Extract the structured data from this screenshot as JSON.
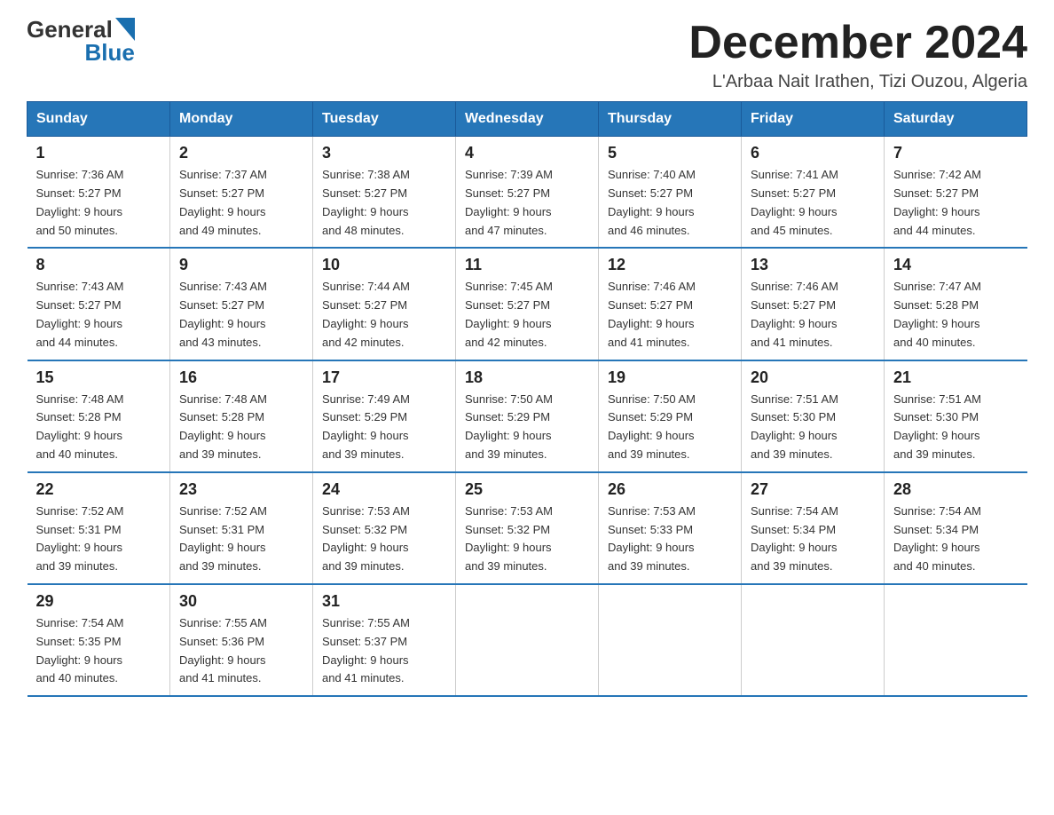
{
  "logo": {
    "general": "General",
    "blue": "Blue"
  },
  "title": "December 2024",
  "location": "L'Arbaa Nait Irathen, Tizi Ouzou, Algeria",
  "weekdays": [
    "Sunday",
    "Monday",
    "Tuesday",
    "Wednesday",
    "Thursday",
    "Friday",
    "Saturday"
  ],
  "weeks": [
    [
      {
        "day": "1",
        "sunrise": "7:36 AM",
        "sunset": "5:27 PM",
        "daylight": "9 hours and 50 minutes."
      },
      {
        "day": "2",
        "sunrise": "7:37 AM",
        "sunset": "5:27 PM",
        "daylight": "9 hours and 49 minutes."
      },
      {
        "day": "3",
        "sunrise": "7:38 AM",
        "sunset": "5:27 PM",
        "daylight": "9 hours and 48 minutes."
      },
      {
        "day": "4",
        "sunrise": "7:39 AM",
        "sunset": "5:27 PM",
        "daylight": "9 hours and 47 minutes."
      },
      {
        "day": "5",
        "sunrise": "7:40 AM",
        "sunset": "5:27 PM",
        "daylight": "9 hours and 46 minutes."
      },
      {
        "day": "6",
        "sunrise": "7:41 AM",
        "sunset": "5:27 PM",
        "daylight": "9 hours and 45 minutes."
      },
      {
        "day": "7",
        "sunrise": "7:42 AM",
        "sunset": "5:27 PM",
        "daylight": "9 hours and 44 minutes."
      }
    ],
    [
      {
        "day": "8",
        "sunrise": "7:43 AM",
        "sunset": "5:27 PM",
        "daylight": "9 hours and 44 minutes."
      },
      {
        "day": "9",
        "sunrise": "7:43 AM",
        "sunset": "5:27 PM",
        "daylight": "9 hours and 43 minutes."
      },
      {
        "day": "10",
        "sunrise": "7:44 AM",
        "sunset": "5:27 PM",
        "daylight": "9 hours and 42 minutes."
      },
      {
        "day": "11",
        "sunrise": "7:45 AM",
        "sunset": "5:27 PM",
        "daylight": "9 hours and 42 minutes."
      },
      {
        "day": "12",
        "sunrise": "7:46 AM",
        "sunset": "5:27 PM",
        "daylight": "9 hours and 41 minutes."
      },
      {
        "day": "13",
        "sunrise": "7:46 AM",
        "sunset": "5:27 PM",
        "daylight": "9 hours and 41 minutes."
      },
      {
        "day": "14",
        "sunrise": "7:47 AM",
        "sunset": "5:28 PM",
        "daylight": "9 hours and 40 minutes."
      }
    ],
    [
      {
        "day": "15",
        "sunrise": "7:48 AM",
        "sunset": "5:28 PM",
        "daylight": "9 hours and 40 minutes."
      },
      {
        "day": "16",
        "sunrise": "7:48 AM",
        "sunset": "5:28 PM",
        "daylight": "9 hours and 39 minutes."
      },
      {
        "day": "17",
        "sunrise": "7:49 AM",
        "sunset": "5:29 PM",
        "daylight": "9 hours and 39 minutes."
      },
      {
        "day": "18",
        "sunrise": "7:50 AM",
        "sunset": "5:29 PM",
        "daylight": "9 hours and 39 minutes."
      },
      {
        "day": "19",
        "sunrise": "7:50 AM",
        "sunset": "5:29 PM",
        "daylight": "9 hours and 39 minutes."
      },
      {
        "day": "20",
        "sunrise": "7:51 AM",
        "sunset": "5:30 PM",
        "daylight": "9 hours and 39 minutes."
      },
      {
        "day": "21",
        "sunrise": "7:51 AM",
        "sunset": "5:30 PM",
        "daylight": "9 hours and 39 minutes."
      }
    ],
    [
      {
        "day": "22",
        "sunrise": "7:52 AM",
        "sunset": "5:31 PM",
        "daylight": "9 hours and 39 minutes."
      },
      {
        "day": "23",
        "sunrise": "7:52 AM",
        "sunset": "5:31 PM",
        "daylight": "9 hours and 39 minutes."
      },
      {
        "day": "24",
        "sunrise": "7:53 AM",
        "sunset": "5:32 PM",
        "daylight": "9 hours and 39 minutes."
      },
      {
        "day": "25",
        "sunrise": "7:53 AM",
        "sunset": "5:32 PM",
        "daylight": "9 hours and 39 minutes."
      },
      {
        "day": "26",
        "sunrise": "7:53 AM",
        "sunset": "5:33 PM",
        "daylight": "9 hours and 39 minutes."
      },
      {
        "day": "27",
        "sunrise": "7:54 AM",
        "sunset": "5:34 PM",
        "daylight": "9 hours and 39 minutes."
      },
      {
        "day": "28",
        "sunrise": "7:54 AM",
        "sunset": "5:34 PM",
        "daylight": "9 hours and 40 minutes."
      }
    ],
    [
      {
        "day": "29",
        "sunrise": "7:54 AM",
        "sunset": "5:35 PM",
        "daylight": "9 hours and 40 minutes."
      },
      {
        "day": "30",
        "sunrise": "7:55 AM",
        "sunset": "5:36 PM",
        "daylight": "9 hours and 41 minutes."
      },
      {
        "day": "31",
        "sunrise": "7:55 AM",
        "sunset": "5:37 PM",
        "daylight": "9 hours and 41 minutes."
      },
      null,
      null,
      null,
      null
    ]
  ],
  "labels": {
    "sunrise": "Sunrise:",
    "sunset": "Sunset:",
    "daylight": "Daylight:"
  }
}
